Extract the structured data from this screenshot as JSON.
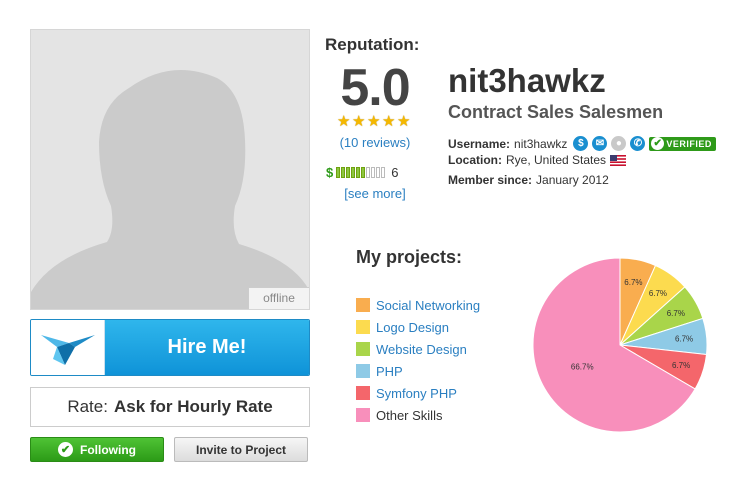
{
  "profile": {
    "status": "offline",
    "username_display": "nit3hawkz",
    "title": "Contract Sales Salesmen",
    "username_label": "Username:",
    "username_value": "nit3hawkz",
    "location_label": "Location:",
    "location_value": "Rye, United States",
    "member_label": "Member since:",
    "member_value": "January 2012",
    "verified_label": "VERIFIED"
  },
  "actions": {
    "hire_label": "Hire Me!",
    "rate_prefix": "Rate:",
    "rate_value": "Ask for Hourly Rate",
    "following_label": "Following",
    "invite_label": "Invite to Project"
  },
  "reputation": {
    "label": "Reputation:",
    "score": "5.0",
    "stars": 5,
    "reviews_link": "(10 reviews)",
    "earnings_symbol": "$",
    "earnings_level": 6,
    "earnings_bars_total": 10,
    "see_more": "[see more]"
  },
  "projects": {
    "title": "My projects:",
    "colors": {
      "social": "#f9ad4f",
      "logo": "#fcdb4f",
      "website": "#a9d54a",
      "php": "#8ecae6",
      "symfony": "#f4666b",
      "other": "#f88fbb"
    }
  },
  "chart_data": {
    "type": "pie",
    "categories": [
      "Social Networking",
      "Logo Design",
      "Website Design",
      "PHP",
      "Symfony PHP",
      "Other Skills"
    ],
    "values": [
      6.7,
      6.7,
      6.7,
      6.7,
      6.7,
      66.7
    ],
    "labels": [
      "6.7%",
      "6.7%",
      "6.7%",
      "6.7%",
      "6.7%",
      "66.7%"
    ],
    "colors": [
      "#f9ad4f",
      "#fcdb4f",
      "#a9d54a",
      "#8ecae6",
      "#f4666b",
      "#f88fbb"
    ],
    "legend_position": "left"
  }
}
